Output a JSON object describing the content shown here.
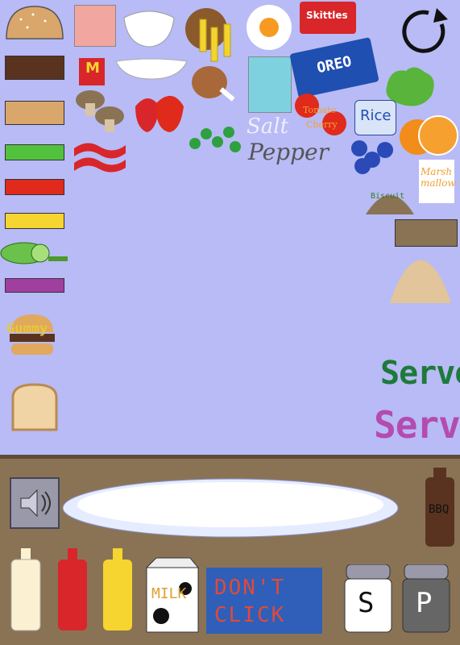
{
  "ingredients": {
    "tomato_label": "Tomato",
    "cherry_label": "Cherry",
    "salt_label": "Salt",
    "pepper_label": "Pepper",
    "rice_label": "Rice",
    "marshmallow_label": "Marsh\nmallow",
    "biscuit_label": "Biscuit",
    "gummy_label": "Gummy",
    "skittles_label": "Skittles",
    "oreo_label": "OREO"
  },
  "buttons": {
    "serve_green": "Serve",
    "serve_purple": "Serve",
    "dont_click": "DON'T CLICK"
  },
  "counter": {
    "milk_label": "MILK",
    "bbq_label": "BBQ",
    "salt_shaker_label": "S",
    "pepper_shaker_label": "P"
  },
  "colors": {
    "background": "#b8bbf5",
    "counter": "#8a7355",
    "serve_green": "#1e7a3a",
    "serve_purple": "#b44bb0",
    "dont_click_bg": "#2f5fb8",
    "dont_click_text": "#e04a3a"
  },
  "icons": [
    "reset-icon",
    "speaker-icon"
  ]
}
